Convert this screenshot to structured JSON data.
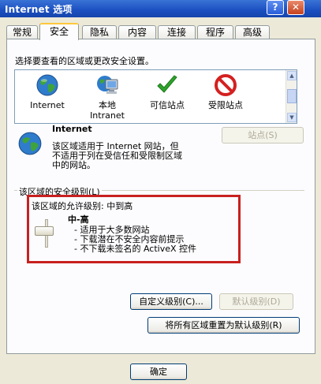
{
  "window": {
    "title": "Internet 选项",
    "help_glyph": "?",
    "close_glyph": "✕"
  },
  "tabs": [
    {
      "label": "常规"
    },
    {
      "label": "安全"
    },
    {
      "label": "隐私"
    },
    {
      "label": "内容"
    },
    {
      "label": "连接"
    },
    {
      "label": "程序"
    },
    {
      "label": "高级"
    }
  ],
  "security": {
    "prompt": "选择要查看的区域或更改安全设置。",
    "zones": [
      {
        "label": "Internet",
        "icon": "globe-icon"
      },
      {
        "label": "本地",
        "label2": "Intranet",
        "icon": "monitor-icon"
      },
      {
        "label": "可信站点",
        "icon": "checkmark-icon"
      },
      {
        "label": "受限站点",
        "icon": "no-entry-icon"
      }
    ],
    "selected_zone": {
      "name": "Internet",
      "description": [
        "该区域适用于 Internet 网站，但",
        "不适用于列在受信任和受限制区域",
        "中的网站。"
      ]
    },
    "sites_button": "站点(S)",
    "level_group_label": "该区域的安全级别(L)",
    "allowed_levels": "该区域的允许级别: 中到高",
    "level_name": "中-高",
    "level_points": [
      "- 适用于大多数网站",
      "- 下载潜在不安全内容前提示",
      "- 不下载未签名的 ActiveX 控件"
    ],
    "custom_level_button": "自定义级别(C)...",
    "default_level_button": "默认级别(D)",
    "reset_all_button": "将所有区域重置为默认级别(R)"
  },
  "footer": {
    "ok_button": "确定"
  },
  "colors": {
    "highlight_box": "#c82020",
    "title_bar": "#1b4fc0",
    "panel": "#fcfcfe",
    "dialog": "#ece9d8"
  }
}
